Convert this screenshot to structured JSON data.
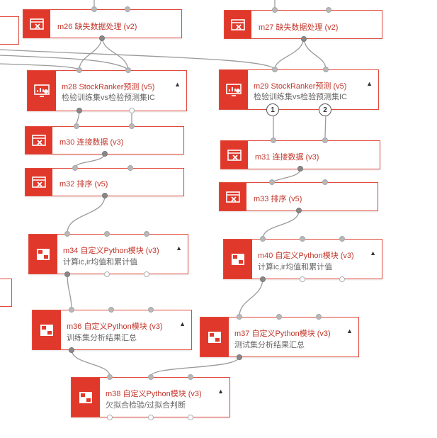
{
  "colors": {
    "accent": "#e0392b",
    "title": "#c3362b",
    "edge": "#9a9a9a"
  },
  "nodes": {
    "m26": {
      "title": "m26 缺失数据处理 (v2)",
      "icon": "data-tool-icon"
    },
    "m27": {
      "title": "m27 缺失数据处理 (v2)",
      "icon": "data-tool-icon"
    },
    "m28": {
      "title": "m28 StockRanker预测 (v5)",
      "sub": "检验训练集vs检验预测集IC",
      "icon": "chart-monitor-icon"
    },
    "m29": {
      "title": "m29 StockRanker预测 (v5)",
      "sub": "检验训练集vs检验预测集IC",
      "icon": "chart-monitor-icon"
    },
    "m30": {
      "title": "m30 连接数据 (v3)",
      "icon": "data-tool-icon"
    },
    "m31": {
      "title": "m31 连接数据 (v3)",
      "icon": "data-tool-icon"
    },
    "m32": {
      "title": "m32 排序 (v5)",
      "icon": "data-tool-icon"
    },
    "m33": {
      "title": "m33 排序 (v5)",
      "icon": "data-tool-icon"
    },
    "m34": {
      "title": "m34 自定义Python模块 (v3)",
      "sub": "计算ic,ir均值和累计值",
      "icon": "python-module-icon"
    },
    "m40": {
      "title": "m40 自定义Python模块 (v3)",
      "sub": "计算ic,ir均值和累计值",
      "icon": "python-module-icon"
    },
    "m36": {
      "title": "m36 自定义Python模块 (v3)",
      "sub": "训练集分析结果汇总",
      "icon": "python-module-icon"
    },
    "m37": {
      "title": "m37 自定义Python模块 (v3)",
      "sub": "测试集分析结果汇总",
      "icon": "python-module-icon"
    },
    "m38": {
      "title": "m38 自定义Python模块 (v3)",
      "sub": "欠拟合检验/过拟合判断",
      "icon": "python-module-icon"
    }
  },
  "badges": {
    "one": "1",
    "two": "2"
  },
  "caret": "▲"
}
